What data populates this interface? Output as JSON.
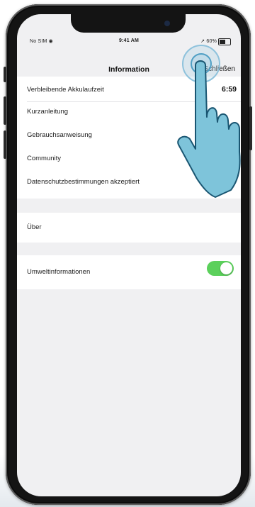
{
  "status_bar": {
    "carrier": "No SIM ◉",
    "time": "9:41 AM",
    "battery_text": "↗ 60%"
  },
  "nav": {
    "title": "Information",
    "action": "Schließen"
  },
  "items": {
    "battery_time_label": "Verbleibende Akkulaufzeit",
    "battery_time_value": "6:59",
    "quick_guide": "Kurzanleitung",
    "manual": "Gebrauchsanweisung",
    "community": "Community",
    "privacy": "Datenschutzbestimmungen akzeptiert",
    "about": "Über",
    "environment": "Umweltinformationen"
  },
  "toggle": {
    "environment_on": true,
    "on_color": "#5bd05b"
  },
  "icons": {
    "hand_pointer": "tap-hand-icon"
  }
}
